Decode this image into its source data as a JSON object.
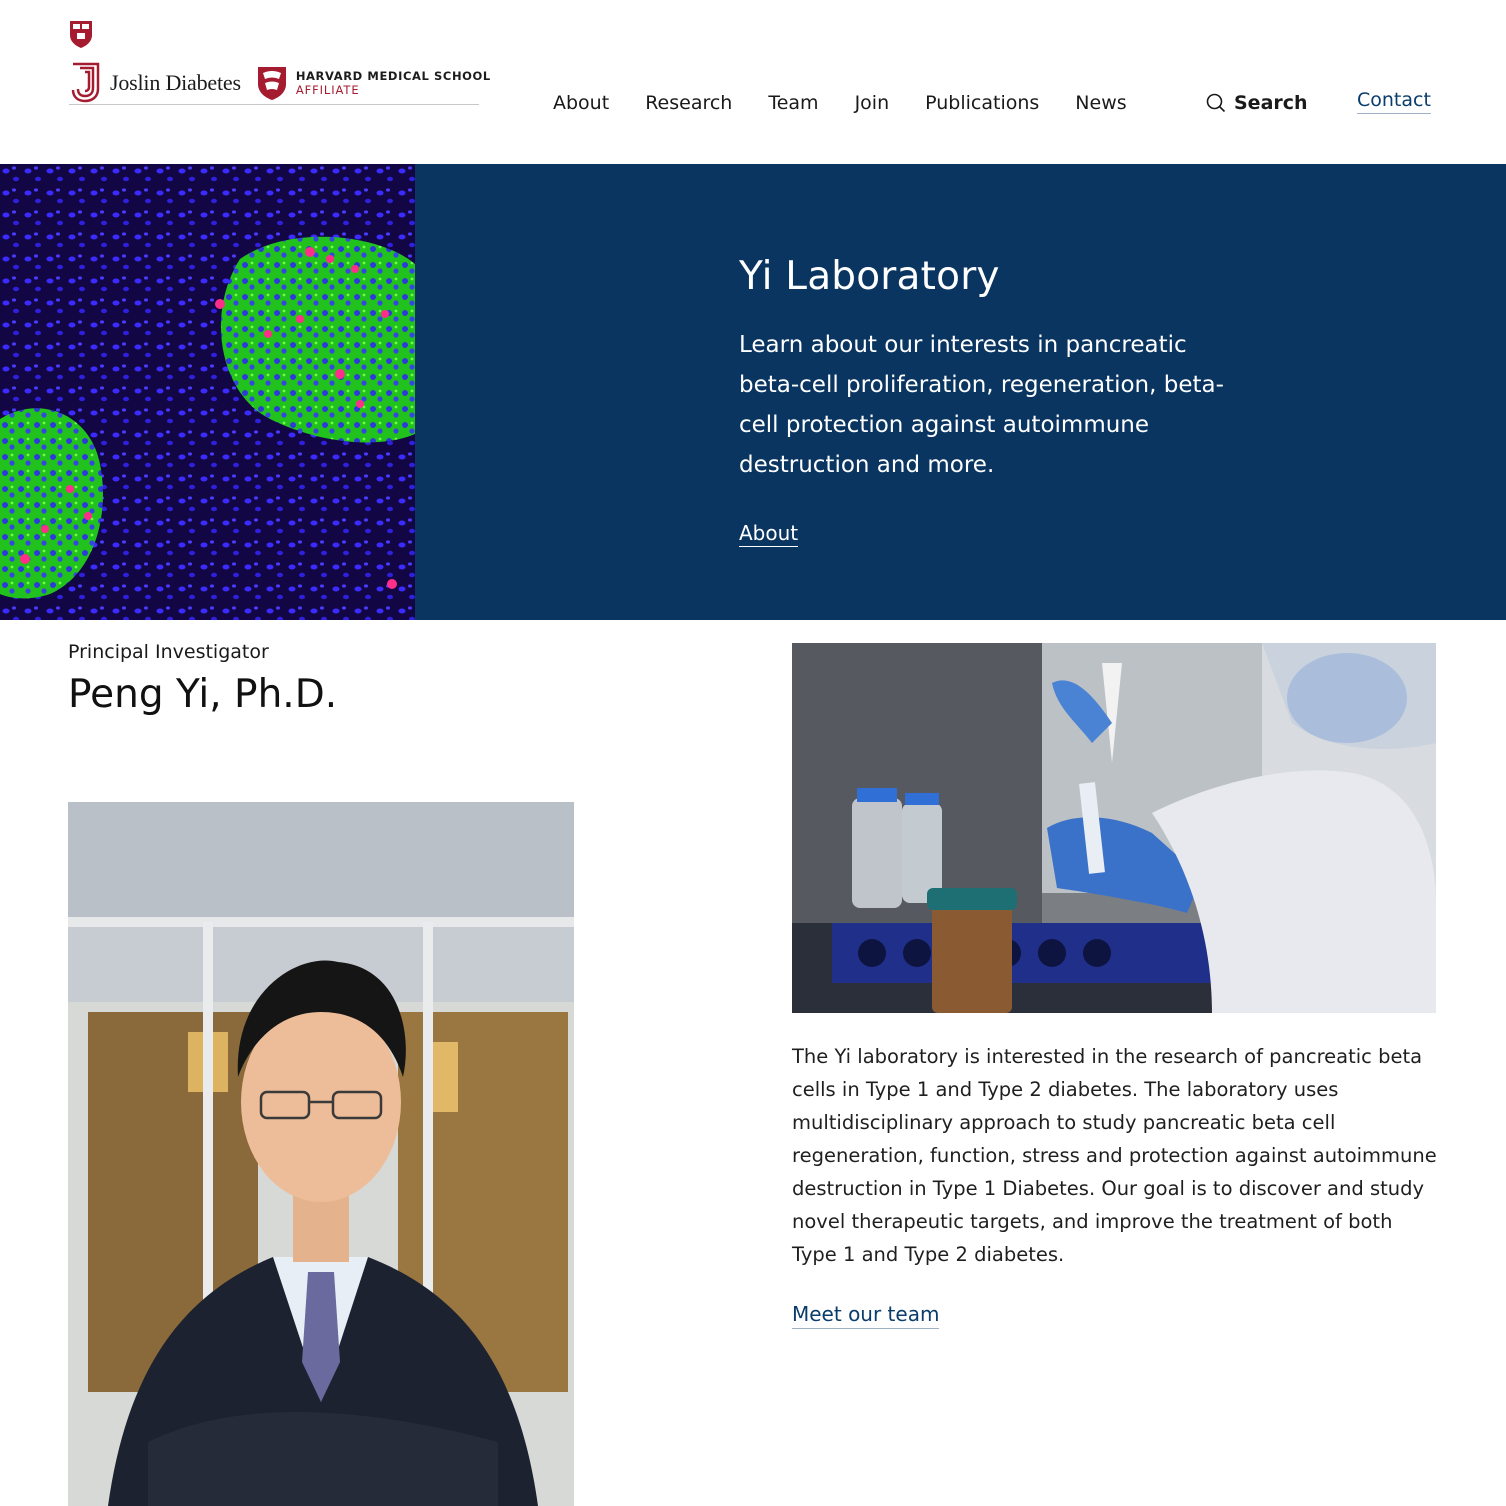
{
  "header": {
    "brand_name": "Joslin Diabetes",
    "affiliate_line1": "HARVARD MEDICAL SCHOOL",
    "affiliate_line2": "AFFILIATE",
    "nav": [
      "About",
      "Research",
      "Team",
      "Join",
      "Publications",
      "News"
    ],
    "search_label": "Search",
    "contact_label": "Contact"
  },
  "hero": {
    "title": "Yi Laboratory",
    "description": "Learn about our interests in pancreatic beta-cell proliferation, regeneration, beta-cell protection against autoimmune destruction and more.",
    "link_label": "About"
  },
  "pi": {
    "label": "Principal Investigator",
    "name": "Peng Yi, Ph.D."
  },
  "lab": {
    "description": "The Yi laboratory is interested in the research of pancreatic beta cells in Type 1 and Type 2 diabetes. The laboratory uses multidisciplinary approach to study pancreatic beta cell regeneration, function, stress and protection against autoimmune destruction in Type 1 Diabetes. Our goal is to discover and study novel therapeutic targets, and improve the treatment of both Type 1 and Type 2 diabetes.",
    "team_link": "Meet our team"
  },
  "colors": {
    "hero_bg": "#0a3561",
    "harvard_crimson": "#a51c30",
    "link_blue": "#0a3d6b"
  },
  "icons": [
    "harvard-shield-icon",
    "joslin-j-icon",
    "hms-shield-icon",
    "search-icon"
  ]
}
